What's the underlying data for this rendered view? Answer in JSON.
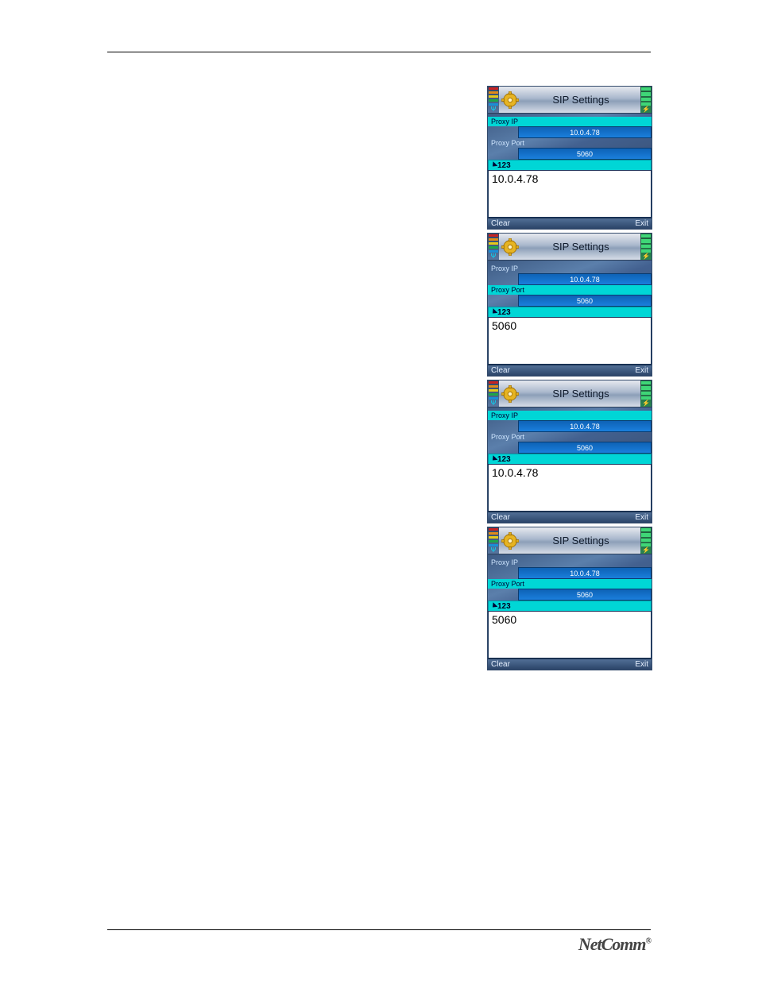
{
  "page": {
    "logo": "NetComm",
    "logo_mark": "®"
  },
  "screens": [
    {
      "title": "SIP Settings",
      "proxy_ip_label": "Proxy IP",
      "proxy_ip_value": "10.0.4.78",
      "proxy_port_label": "Proxy Port",
      "proxy_port_value": "5060",
      "mode": "123",
      "input_value": "10.0.4.78",
      "soft_left": "Clear",
      "soft_right": "Exit",
      "highlight": "ip"
    },
    {
      "title": "SIP Settings",
      "proxy_ip_label": "Proxy IP",
      "proxy_ip_value": "10.0.4.78",
      "proxy_port_label": "Proxy Port",
      "proxy_port_value": "5060",
      "mode": "123",
      "input_value": "5060",
      "soft_left": "Clear",
      "soft_right": "Exit",
      "highlight": "port"
    },
    {
      "title": "SIP Settings",
      "proxy_ip_label": "Proxy IP",
      "proxy_ip_value": "10.0.4.78",
      "proxy_port_label": "Proxy Port",
      "proxy_port_value": "5060",
      "mode": "123",
      "input_value": "10.0.4.78",
      "soft_left": "Clear",
      "soft_right": "Exit",
      "highlight": "ip"
    },
    {
      "title": "SIP Settings",
      "proxy_ip_label": "Proxy IP",
      "proxy_ip_value": "10.0.4.78",
      "proxy_port_label": "Proxy Port",
      "proxy_port_value": "5060",
      "mode": "123",
      "input_value": "5060",
      "soft_left": "Clear",
      "soft_right": "Exit",
      "highlight": "port"
    }
  ]
}
